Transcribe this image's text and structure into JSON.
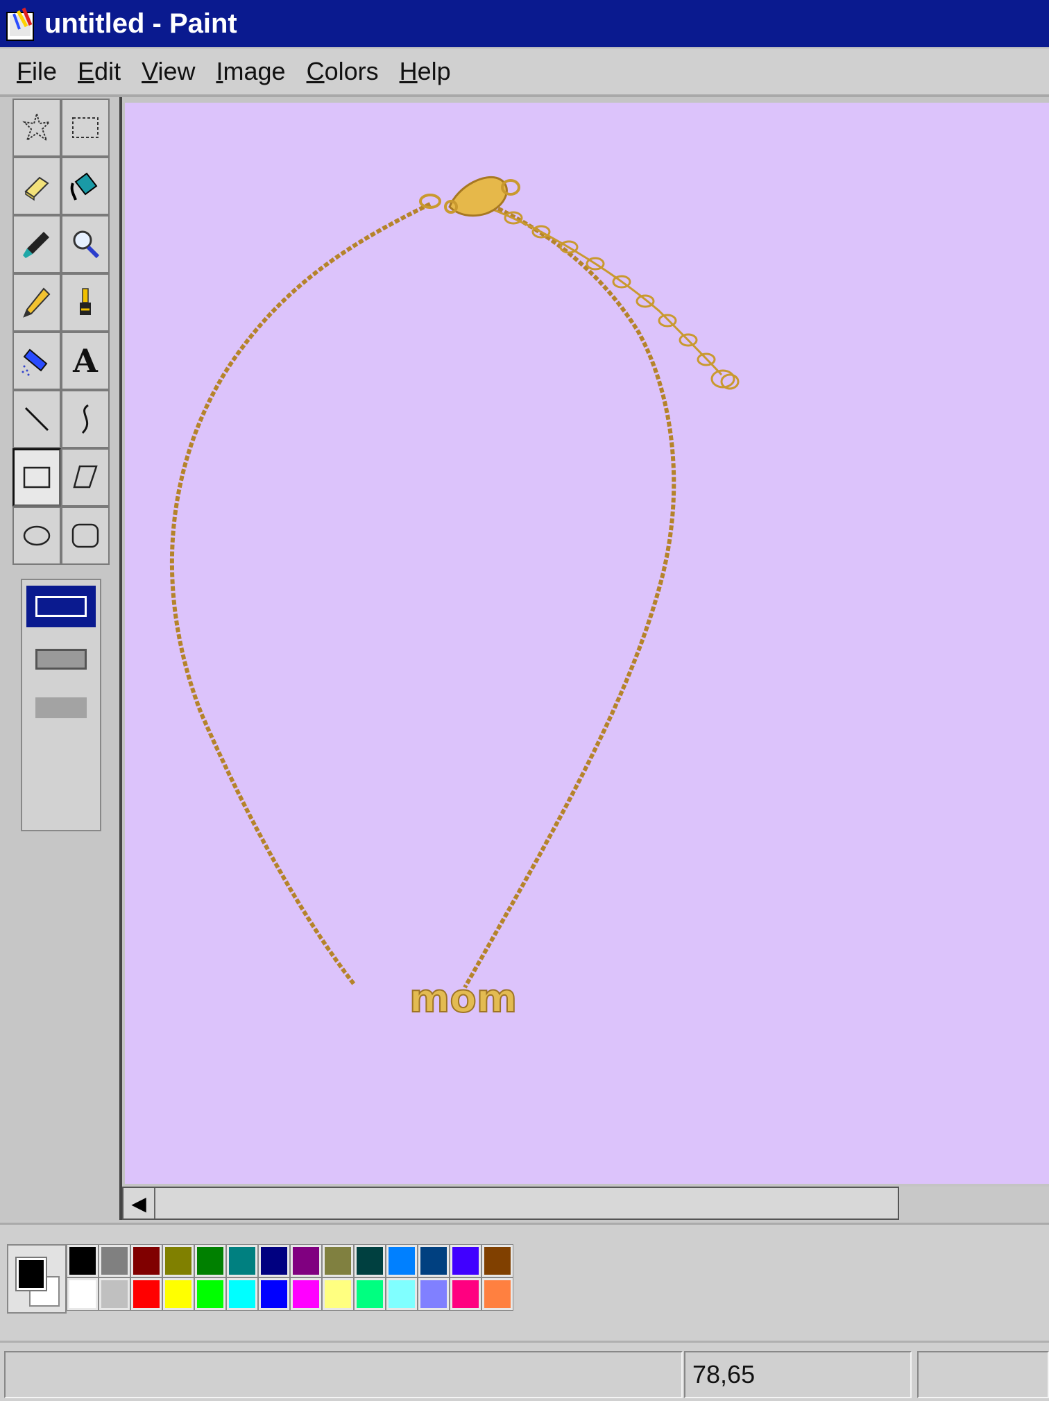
{
  "window": {
    "title": "untitled - Paint"
  },
  "menu": [
    {
      "label": "File",
      "key": "F",
      "rest": "ile"
    },
    {
      "label": "Edit",
      "key": "E",
      "rest": "dit"
    },
    {
      "label": "View",
      "key": "V",
      "rest": "iew"
    },
    {
      "label": "Image",
      "key": "I",
      "rest": "mage"
    },
    {
      "label": "Colors",
      "key": "C",
      "rest": "olors"
    },
    {
      "label": "Help",
      "key": "H",
      "rest": "elp"
    }
  ],
  "tools": [
    "free-form-select-icon",
    "rectangle-select-icon",
    "eraser-icon",
    "fill-bucket-icon",
    "eyedropper-icon",
    "magnifier-icon",
    "pencil-icon",
    "brush-icon",
    "airbrush-icon",
    "text-icon",
    "line-icon",
    "curve-icon",
    "rectangle-icon",
    "polygon-icon",
    "ellipse-icon",
    "rounded-rectangle-icon"
  ],
  "active_tool": "rectangle-icon",
  "tool_text_glyph": "A",
  "canvas": {
    "background": "#dcc3fb",
    "image": "gold-mom-necklace",
    "pendant_text": "mom"
  },
  "palette": {
    "foreground": "#000000",
    "background": "#ffffff",
    "colors": [
      "#000000",
      "#808080",
      "#800000",
      "#808000",
      "#008000",
      "#008080",
      "#000080",
      "#800080",
      "#808040",
      "#004040",
      "#0080ff",
      "#004080",
      "#4000ff",
      "#804000",
      "#ffffff",
      "#c0c0c0",
      "#ff0000",
      "#ffff00",
      "#00ff00",
      "#00ffff",
      "#0000ff",
      "#ff00ff",
      "#ffff80",
      "#00ff80",
      "#80ffff",
      "#8080ff",
      "#ff0080",
      "#ff8040"
    ]
  },
  "status": {
    "coords": "78,65"
  }
}
